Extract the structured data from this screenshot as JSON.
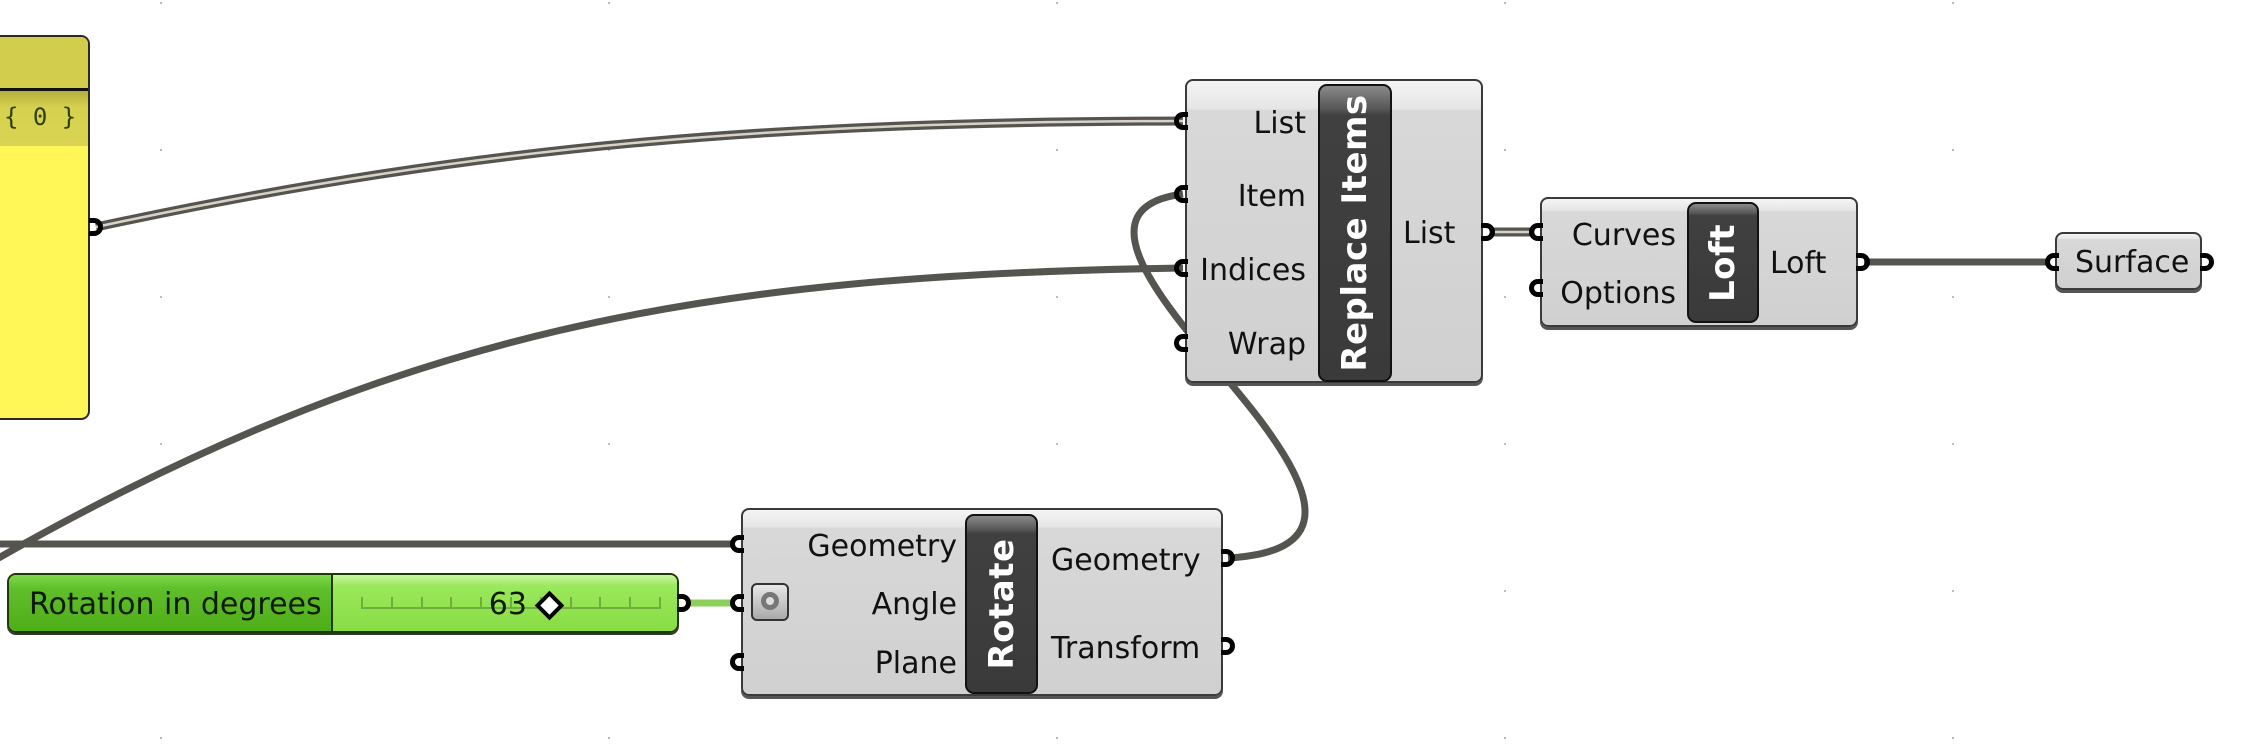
{
  "canvas": {
    "background": "#ffffff",
    "wire_color": "#55544f"
  },
  "panel": {
    "path_label": "{ 0 }",
    "fill_color": "#fff757",
    "header_color": "#d2cd4c"
  },
  "slider": {
    "name": "Rotation in degrees",
    "value": "63",
    "value_fraction": 0.63,
    "fill_color": "#5fbe2a"
  },
  "components": {
    "replace_items": {
      "nickname": "Replace Items",
      "inputs": [
        "List",
        "Item",
        "Indices",
        "Wrap"
      ],
      "outputs": [
        "List"
      ]
    },
    "loft": {
      "nickname": "Loft",
      "inputs": [
        "Curves",
        "Options"
      ],
      "outputs": [
        "Loft"
      ]
    },
    "rotate": {
      "nickname": "Rotate",
      "inputs": [
        "Geometry",
        "Angle",
        "Plane"
      ],
      "outputs": [
        "Geometry",
        "Transform"
      ]
    },
    "surface": {
      "label": "Surface"
    }
  },
  "wires": [
    {
      "from": "panel.output",
      "to": "replace_items.List",
      "kind": "list"
    },
    {
      "from": "rotate.Geometry",
      "to": "replace_items.Item",
      "kind": "item"
    },
    {
      "from": "offscreen-left",
      "to": "replace_items.Indices",
      "kind": "item"
    },
    {
      "from": "offscreen-left",
      "to": "rotate.Geometry",
      "kind": "item"
    },
    {
      "from": "slider.output",
      "to": "rotate.Angle",
      "kind": "slider"
    },
    {
      "from": "replace_items.List",
      "to": "loft.Curves",
      "kind": "list"
    },
    {
      "from": "loft.Loft",
      "to": "surface.input",
      "kind": "item"
    }
  ]
}
